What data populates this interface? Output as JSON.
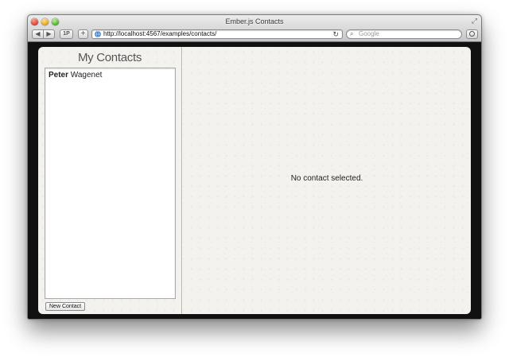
{
  "window": {
    "title": "Ember.js Contacts"
  },
  "toolbar": {
    "back_label": "◀",
    "forward_label": "▶",
    "reader_label": "1P",
    "add_label": "+",
    "url": "http://localhost:4567/examples/contacts/",
    "search_placeholder": "Google",
    "icons": {
      "back": "back-arrow-icon",
      "forward": "forward-arrow-icon",
      "globe": "globe-icon",
      "reload": "reload-icon",
      "search": "search-icon",
      "downloads": "downloads-icon",
      "fullscreen": "fullscreen-icon"
    }
  },
  "app": {
    "sidebar_title": "My Contacts",
    "contacts": [
      {
        "first_name": "Peter",
        "last_name": "Wagenet"
      }
    ],
    "new_contact_label": "New Contact",
    "empty_message": "No contact selected."
  },
  "colors": {
    "app_background": "#f4f2ee",
    "frame_background": "#111111",
    "close": "#e0443a",
    "minimize": "#e6a92a",
    "zoom": "#58b43a"
  }
}
